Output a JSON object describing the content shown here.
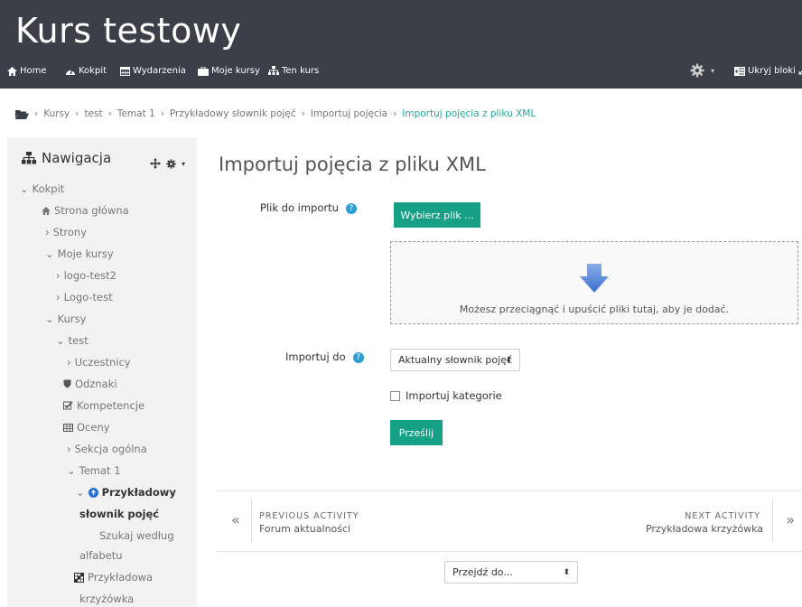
{
  "header": {
    "site_title": "Kurs testowy",
    "nav_items": [
      {
        "label": "Home",
        "icon": "home-icon"
      },
      {
        "label": "Kokpit",
        "icon": "dashboard-icon"
      },
      {
        "label": "Wydarzenia",
        "icon": "calendar-icon"
      },
      {
        "label": "Moje kursy",
        "icon": "briefcase-icon"
      },
      {
        "label": "Ten kurs",
        "icon": "sitemap-icon"
      }
    ],
    "hide_blocks_label": "Ukryj bloki"
  },
  "breadcrumb": {
    "items": [
      "Kursy",
      "test",
      "Temat 1",
      "Przykładowy słownik pojęć",
      "Importuj pojęcia"
    ],
    "current": "Importuj pojęcia z pliku XML"
  },
  "sidebar": {
    "title": "Nawigacja",
    "tree": [
      {
        "label": "Kokpit",
        "prefix": "⌄"
      },
      {
        "label": "Strona główna",
        "prefix": "",
        "icon": "home-icon"
      },
      {
        "label": "Strony",
        "prefix": "›"
      },
      {
        "label": "Moje kursy",
        "prefix": "⌄"
      },
      {
        "label": "logo-test2",
        "prefix": "›"
      },
      {
        "label": "Logo-test",
        "prefix": "›"
      },
      {
        "label": "Kursy",
        "prefix": "⌄"
      },
      {
        "label": "test",
        "prefix": "⌄"
      },
      {
        "label": "Uczestnicy",
        "prefix": "›"
      },
      {
        "label": "Odznaki",
        "prefix": "",
        "icon": "shield-icon"
      },
      {
        "label": "Kompetencje",
        "prefix": "",
        "icon": "check-square-icon"
      },
      {
        "label": "Oceny",
        "prefix": "",
        "icon": "table-icon"
      },
      {
        "label": "Sekcja ogólna",
        "prefix": "›"
      },
      {
        "label": "Temat 1",
        "prefix": "⌄"
      },
      {
        "label": "Przykładowy",
        "prefix": "⌄",
        "icon": "glossary-icon"
      },
      {
        "label": "słownik pojęć",
        "prefix": ""
      },
      {
        "label": "Szukaj według",
        "prefix": ""
      },
      {
        "label": "alfabetu",
        "prefix": ""
      },
      {
        "label": "Przykładowa",
        "prefix": "",
        "icon": "crossword-icon"
      },
      {
        "label": "krzyżówka",
        "prefix": ""
      }
    ]
  },
  "main": {
    "title": "Importuj pojęcia z pliku XML",
    "file_label": "Plik do importu",
    "choose_file_button": "Wybierz plik ...",
    "dropzone_text": "Możesz przeciągnąć i upuścić pliki tutaj, aby je dodać.",
    "import_to_label": "Importuj do",
    "import_to_value": "Aktualny słownik pojęć",
    "import_categories_label": "Importuj kategorie",
    "submit_button": "Prześlij"
  },
  "activity_nav": {
    "previous_label": "PREVIOUS ACTIVITY",
    "previous_name": "Forum aktualności",
    "next_label": "NEXT ACTIVITY",
    "next_name": "Przykładowa krzyżówka",
    "jump_to_placeholder": "Przejdź do..."
  },
  "colors": {
    "header_bg": "#3a3f48",
    "accent": "#16a085",
    "link_active": "#26a69a",
    "help_icon": "#2a9fd6"
  }
}
